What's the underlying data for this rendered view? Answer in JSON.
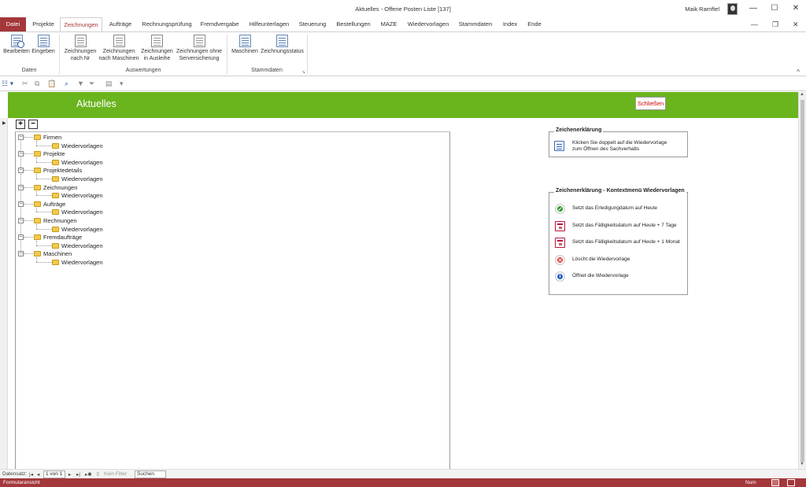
{
  "window": {
    "title": "Aktuelles  -  Offene Posten Liste [137]",
    "user": "Maik Ramftel",
    "minimize": "—",
    "maximize": "☐",
    "close": "✕",
    "inner_minimize": "—",
    "inner_restore": "❐",
    "inner_close": "✕"
  },
  "ribbon_tabs": [
    "Datei",
    "Projekte",
    "Zeichnungen",
    "Aufträge",
    "Rechnungsprüfung",
    "Fremdvergabe",
    "Hilfeunterlagen",
    "Steuerung",
    "Bestellungen",
    "MAZE",
    "Wiedervorlagen",
    "Stammdaten",
    "Index",
    "Ende"
  ],
  "active_tab": "Zeichnungen",
  "ribbon": {
    "groups": {
      "daten": "Daten",
      "auswertungen": "Auswertungen",
      "stammdaten": "Stammdaten"
    },
    "buttons": {
      "bearbeiten": "Bearbeiten",
      "eingeben": "Eingeben",
      "nach_nr_1": "Zeichnungen",
      "nach_nr_2": "nach Nr",
      "nach_maschinen_1": "Zeichnungen",
      "nach_maschinen_2": "nach Maschinen",
      "in_ausleihe_1": "Zeichnungen",
      "in_ausleihe_2": "in Ausleihe",
      "ohne_sicherung_1": "Zeichnungen ohne",
      "ohne_sicherung_2": "Serversicherung",
      "maschinen": "Maschinen",
      "zeichnungsstatus": "Zeichnungsstatus"
    },
    "launcher_glyph": "↘",
    "collapse_glyph": "^"
  },
  "quick_access": {
    "view_icon": "☷ ▾",
    "cut_icon": "✂",
    "copy_icon": "⧉",
    "paste_icon": "📋",
    "find_icon": "⌕",
    "filter_icon": "▼",
    "filter2_icon": "⏷",
    "doc_icon": "▤",
    "more_icon": "▾"
  },
  "form": {
    "title": "Aktuelles",
    "close_button": "Schließen"
  },
  "tree": {
    "expand_all": "+",
    "collapse_all": "−",
    "nodes": [
      {
        "label": "Firmen",
        "child": "Wiedervorlagen"
      },
      {
        "label": "Projekte",
        "child": "Wiedervorlagen"
      },
      {
        "label": "Projektedetails",
        "child": "Wiedervorlagen"
      },
      {
        "label": "Zeichnungen",
        "child": "Wiedervorlagen"
      },
      {
        "label": "Aufträge",
        "child": "Wiedervorlagen"
      },
      {
        "label": "Rechnungen",
        "child": "Wiedervorlagen"
      },
      {
        "label": "Fremdaufträge",
        "child": "Wiedervorlagen"
      },
      {
        "label": "Maschinen",
        "child": "Wiedervorlagen"
      }
    ]
  },
  "legend1": {
    "title": "Zeichenerklärung",
    "line1": "Klicken Sie doppelt auf die Wiedervorlage",
    "line2": "zum Öffnen des Sachverhalts"
  },
  "legend2": {
    "title": "Zeichenerklärung - Kontextmenü Wiedervorlagen",
    "items": [
      {
        "text": "Setzt das Erledigungdatum auf Heute",
        "icon": "check-icon",
        "color": "#2e9b2e",
        "glyph": "✓"
      },
      {
        "text": "Setzt das Fälligkeitsdatum auf Heute + 7 Tage",
        "icon": "calendar-icon",
        "color": "#b11144",
        "glyph": ""
      },
      {
        "text": "Setzt das Fälligkeitsdatum auf Heute + 1 Monat",
        "icon": "calendar-icon",
        "color": "#b11144",
        "glyph": ""
      },
      {
        "text": "Löscht die Wiedervorlage",
        "icon": "delete-icon",
        "color": "#d9302c",
        "glyph": "✕"
      },
      {
        "text": "Öffnet die Wiedervorlage",
        "icon": "info-icon",
        "color": "#1f5fbf",
        "glyph": "i"
      }
    ]
  },
  "record_nav": {
    "label": "Datensatz:",
    "first": "|◂",
    "prev": "◂",
    "position": "1 von 1",
    "next": "▸",
    "last": "▸|",
    "new": "▸✱",
    "filter": "Kein Filter",
    "search_placeholder": "Suchen"
  },
  "status_bar": {
    "view": "Formularansicht",
    "num": "Num"
  },
  "colors": {
    "accent": "#a4373a",
    "header_green": "#6ab41e"
  }
}
